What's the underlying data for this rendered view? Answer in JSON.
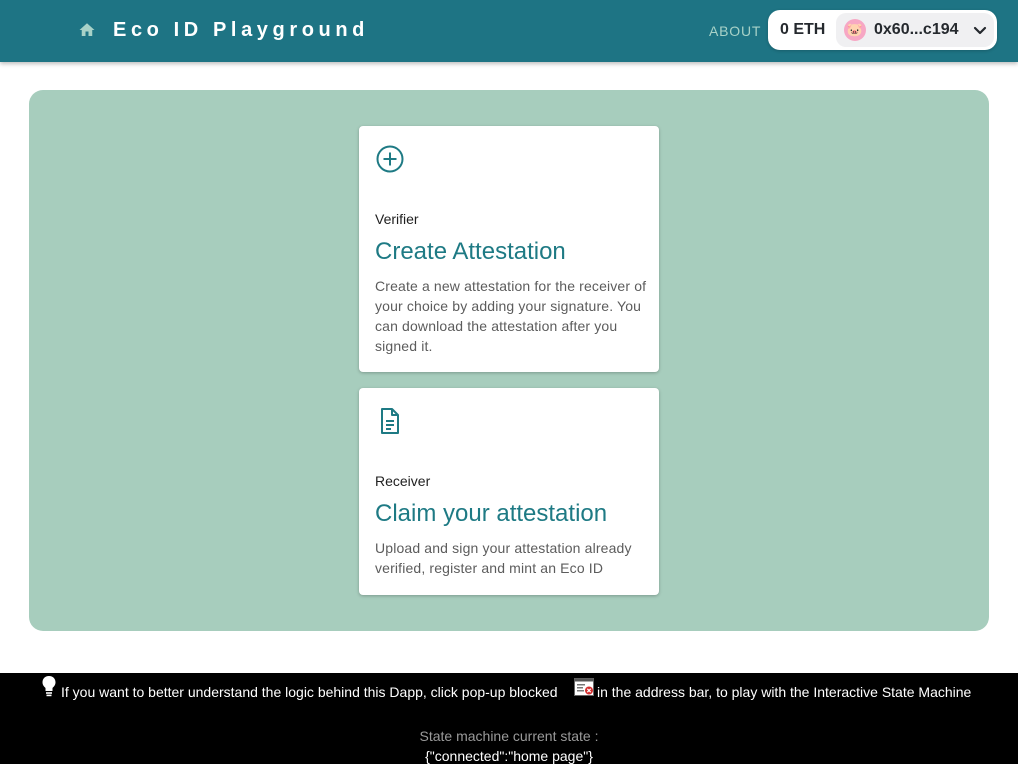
{
  "header": {
    "title": "Eco ID Playground",
    "home_icon": "home-icon",
    "about_label": "ABOUT",
    "background_color": "#1e7484"
  },
  "wallet": {
    "balance": "0 ETH",
    "address": "0x60...c194",
    "avatar_emoji": "🐷",
    "dropdown_icon": "chevron-down-icon"
  },
  "cards": [
    {
      "icon": "add-circle-icon",
      "overline": "Verifier",
      "title": "Create Attestation",
      "description": "Create a new attestation for the receiver of your choice by adding your signature. You can download the attestation after you signed it."
    },
    {
      "icon": "document-icon",
      "overline": "Receiver",
      "title": "Claim your attestation",
      "description": "Upload and sign your attestation already verified, register and mint an Eco ID"
    }
  ],
  "footer": {
    "bulb_icon": "lightbulb-icon",
    "info_text_before": "If you want to better understand the logic behind this Dapp, click pop-up blocked",
    "popup_icon": "popup-blocked-icon",
    "info_text_after": "in the address bar, to play with the Interactive State Machine",
    "state_label": "State machine current state :",
    "state_value": "{\"connected\":\"home page\"}"
  },
  "colors": {
    "accent": "#1e7a84",
    "panel": "#a7cdbd",
    "about_link": "#a8d2c8"
  }
}
